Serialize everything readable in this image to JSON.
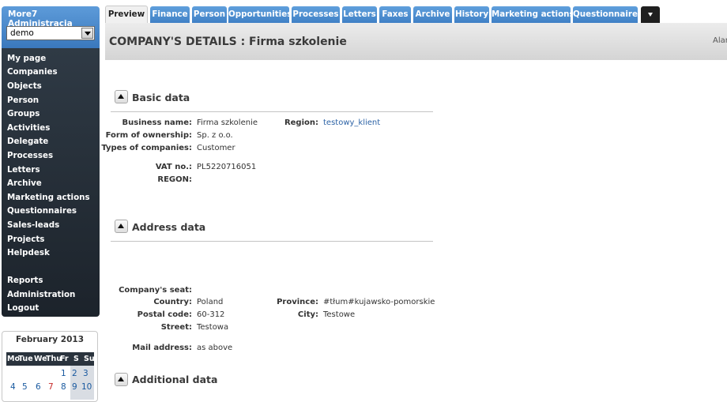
{
  "app": {
    "title": "More7 Administracja",
    "database": "demo"
  },
  "nav": [
    "My page",
    "Companies",
    "Objects",
    "Person",
    "Groups",
    "Activities",
    "Delegate",
    "Processes",
    "Letters",
    "Archive",
    "Marketing actions",
    "Questionnaires",
    "Sales-leads",
    "Projects",
    "Helpdesk"
  ],
  "nav_bottom": [
    "Reports",
    "Administration",
    "Logout"
  ],
  "calendar": {
    "title": "February 2013",
    "weekdays": [
      "Mo",
      "Tue",
      "We",
      "Thu",
      "Fr",
      "S",
      "Su"
    ],
    "row1": [
      "",
      "",
      "",
      "",
      "1",
      "2",
      "3"
    ],
    "row2": [
      "4",
      "5",
      "6",
      "7",
      "8",
      "9",
      "10"
    ],
    "today": "7"
  },
  "tabs": [
    "Preview",
    "Finance",
    "Person",
    "Opportunities",
    "Processes",
    "Letters",
    "Faxes",
    "Archive",
    "History",
    "Marketing actions",
    "Questionnaires"
  ],
  "header": {
    "title": "COMPANY'S DETAILS : Firma szkolenie",
    "right": "Alar"
  },
  "basic": {
    "title": "Basic data",
    "business_name_label": "Business name:",
    "business_name": "Firma szkolenie",
    "region_label": "Region:",
    "region": "testowy_klient",
    "ownership_label": "Form of ownership:",
    "ownership": "Sp. z o.o.",
    "types_label": "Types of companies:",
    "types": "Customer",
    "vat_label": "VAT no.:",
    "vat": "PL5220716051",
    "regon_label": "REGON:",
    "regon": ""
  },
  "address": {
    "title": "Address data",
    "seat_label": "Company's seat:",
    "country_label": "Country:",
    "country": "Poland",
    "province_label": "Province:",
    "province": "#tłum#kujawsko-pomorskie",
    "postal_label": "Postal code:",
    "postal": "60-312",
    "city_label": "City:",
    "city": "Testowe",
    "street_label": "Street:",
    "street": "Testowa",
    "mail_label": "Mail address:",
    "mail": "as above"
  },
  "additional": {
    "title": "Additional data"
  }
}
